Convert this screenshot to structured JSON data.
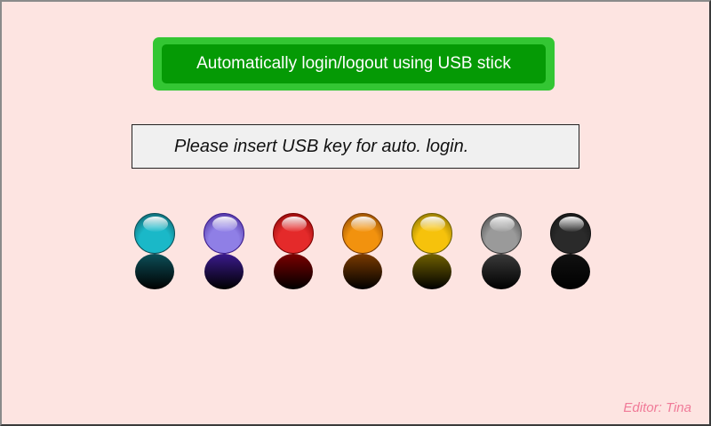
{
  "header": {
    "title": "Automatically login/logout using USB stick"
  },
  "status": {
    "message": "Please insert USB key for auto. login."
  },
  "indicators": [
    {
      "name": "cyan",
      "color": "#1ab8c8",
      "dark": "#0c4f58"
    },
    {
      "name": "violet",
      "color": "#8f7fe6",
      "dark": "#3a1a8c"
    },
    {
      "name": "red",
      "color": "#e42a2a",
      "dark": "#7a0000"
    },
    {
      "name": "orange",
      "color": "#f2920e",
      "dark": "#7a3a00"
    },
    {
      "name": "yellow",
      "color": "#f6c20c",
      "dark": "#706000"
    },
    {
      "name": "silver",
      "color": "#9a9a9a",
      "dark": "#3a3a3a"
    },
    {
      "name": "black",
      "color": "#2a2a2a",
      "dark": "#111111"
    }
  ],
  "footer": {
    "editor": "Editor: Tina"
  },
  "colors": {
    "background": "#fde4e1",
    "title_outer": "#33c633",
    "title_inner": "#059a05",
    "status_bg": "#f0f0f0",
    "editor_text": "#f07a98"
  }
}
